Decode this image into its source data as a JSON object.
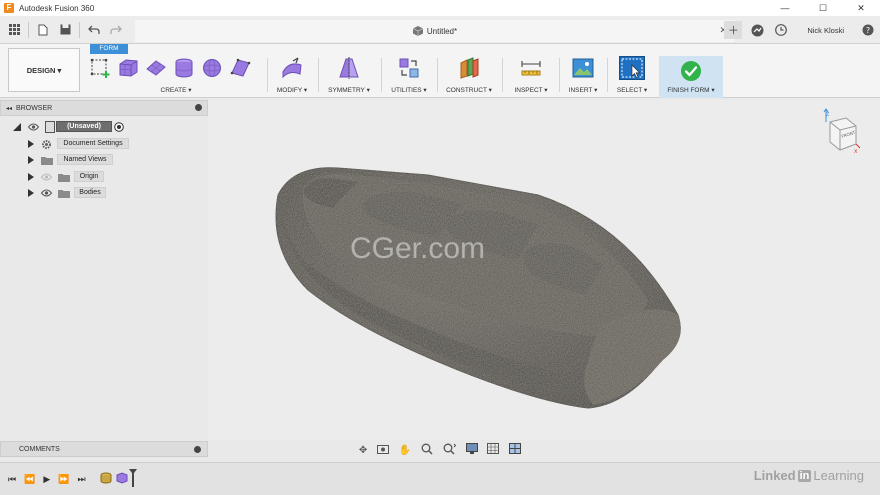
{
  "window": {
    "app_title": "Autodesk Fusion 360",
    "minimize": "—",
    "maximize": "☐",
    "close": "✕"
  },
  "document": {
    "tab_title": "Untitled*",
    "tab_close": "✕"
  },
  "user": {
    "name": "Nick Kloski"
  },
  "toolbar": {
    "workspace": "DESIGN ▾",
    "active_tab": "FORM",
    "groups": {
      "create": "CREATE ▾",
      "modify": "MODIFY ▾",
      "symmetry": "SYMMETRY ▾",
      "utilities": "UTILITIES ▾",
      "construct": "CONSTRUCT ▾",
      "inspect": "INSPECT ▾",
      "insert": "INSERT ▾",
      "select": "SELECT ▾",
      "finish_form": "FINISH FORM ▾"
    }
  },
  "browser": {
    "title": "BROWSER",
    "collapse": "◂◂",
    "root": "(Unsaved)",
    "items": [
      {
        "label": "Document Settings"
      },
      {
        "label": "Named Views"
      },
      {
        "label": "Origin"
      },
      {
        "label": "Bodies"
      }
    ]
  },
  "comments": {
    "title": "COMMENTS"
  },
  "viewcube": {
    "front_label": "FRONT"
  },
  "watermark": {
    "site": "CGer.com",
    "brand_a": "Linked",
    "brand_b": "in",
    "brand_c": " Learning"
  },
  "colors": {
    "accent_blue": "#3d8fd8",
    "form_purple": "#8f6bd6",
    "finish_green": "#31b24a",
    "model_dark": "#4a4640"
  }
}
